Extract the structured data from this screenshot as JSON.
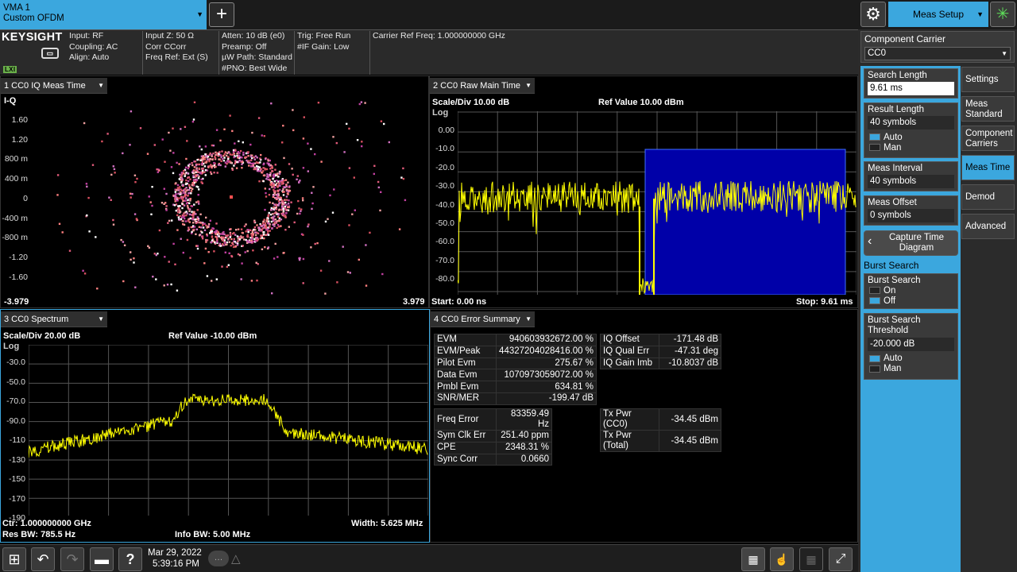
{
  "app_tab": {
    "line1": "VMA 1",
    "line2": "Custom OFDM"
  },
  "top_right": {
    "meas_setup_label": "Meas Setup"
  },
  "brand": {
    "name": "KEYSIGHT",
    "lxi": "LXI"
  },
  "info": {
    "col1": [
      "Input: RF",
      "Coupling: AC",
      "Align: Auto"
    ],
    "col2": [
      "Input Z: 50 Ω",
      "Corr CCorr",
      "Freq Ref: Ext (S)"
    ],
    "col3": [
      "Atten: 10 dB (e0)",
      "Preamp: Off",
      "µW Path: Standard",
      "#PNO: Best Wide"
    ],
    "col4": [
      "Trig: Free Run",
      "#IF Gain: Low"
    ],
    "col5": [
      "Carrier Ref Freq: 1.000000000 GHz"
    ]
  },
  "panel1": {
    "title": "1 CC0 IQ Meas Time",
    "label": "I-Q",
    "y_ticks": [
      "1.60",
      "1.20",
      "800 m",
      "400 m",
      "0",
      "-400 m",
      "-800 m",
      "-1.20",
      "-1.60"
    ],
    "x_min": "-3.979",
    "x_max": "3.979"
  },
  "panel2": {
    "title": "2 CC0 Raw Main Time",
    "scale": "Scale/Div 10.00 dB",
    "ref": "Ref Value 10.00 dBm",
    "log": "Log",
    "y_ticks": [
      "0.00",
      "-10.0",
      "-20.0",
      "-30.0",
      "-40.0",
      "-50.0",
      "-60.0",
      "-70.0",
      "-80.0"
    ],
    "start": "Start: 0.00 ns",
    "stop": "Stop: 9.61 ms"
  },
  "panel3": {
    "title": "3 CC0 Spectrum",
    "scale": "Scale/Div 20.00 dB",
    "ref": "Ref Value -10.00 dBm",
    "log": "Log",
    "y_ticks": [
      "-30.0",
      "-50.0",
      "-70.0",
      "-90.0",
      "-110",
      "-130",
      "-150",
      "-170",
      "-190"
    ],
    "ctr": "Ctr: 1.000000000 GHz",
    "res_bw": "Res BW: 785.5 Hz",
    "info_bw": "Info BW: 5.00 MHz",
    "width": "Width: 5.625 MHz"
  },
  "panel4": {
    "title": "4 CC0 Error Summary",
    "table1": [
      [
        "EVM",
        "940603932672.00 %"
      ],
      [
        "EVM/Peak",
        "44327204028416.00 %"
      ],
      [
        "Pilot Evm",
        "275.67 %"
      ],
      [
        "Data Evm",
        "1070973059072.00 %"
      ],
      [
        "Pmbl Evm",
        "634.81 %"
      ],
      [
        "SNR/MER",
        "-199.47 dB"
      ]
    ],
    "table2": [
      [
        "IQ Offset",
        "-171.48 dB"
      ],
      [
        "IQ Qual Err",
        "-47.31 deg"
      ],
      [
        "IQ Gain Imb",
        "-10.8037 dB"
      ]
    ],
    "table3": [
      [
        "Freq Error",
        "83359.49 Hz"
      ],
      [
        "Sym Clk Err",
        "251.40 ppm"
      ],
      [
        "CPE",
        "2348.31 %"
      ],
      [
        "Sync Corr",
        "0.0660"
      ]
    ],
    "table4": [
      [
        "Tx Pwr (CC0)",
        "-34.45 dBm"
      ],
      [
        "Tx Pwr (Total)",
        "-34.45 dBm"
      ]
    ]
  },
  "right": {
    "component_carrier_label": "Component Carrier",
    "component_carrier_value": "CC0",
    "search_length_label": "Search Length",
    "search_length_value": "9.61 ms",
    "result_length_label": "Result Length",
    "result_length_value": "40 symbols",
    "auto": "Auto",
    "man": "Man",
    "meas_interval_label": "Meas Interval",
    "meas_interval_value": "40 symbols",
    "meas_offset_label": "Meas Offset",
    "meas_offset_value": "0 symbols",
    "capture_time": "Capture Time Diagram",
    "burst_search_header": "Burst Search",
    "burst_search_label": "Burst Search",
    "on": "On",
    "off": "Off",
    "burst_threshold_label": "Burst Search Threshold",
    "burst_threshold_value": "-20.000 dB",
    "tabs": [
      "Settings",
      "Meas Standard",
      "Component Carriers",
      "Meas Time",
      "Demod",
      "Advanced"
    ]
  },
  "status": {
    "date": "Mar 29, 2022",
    "time": "5:39:16 PM"
  },
  "colors": {
    "accent": "#3ba7de",
    "trace": "#ffff00",
    "window": "#0000a0"
  }
}
